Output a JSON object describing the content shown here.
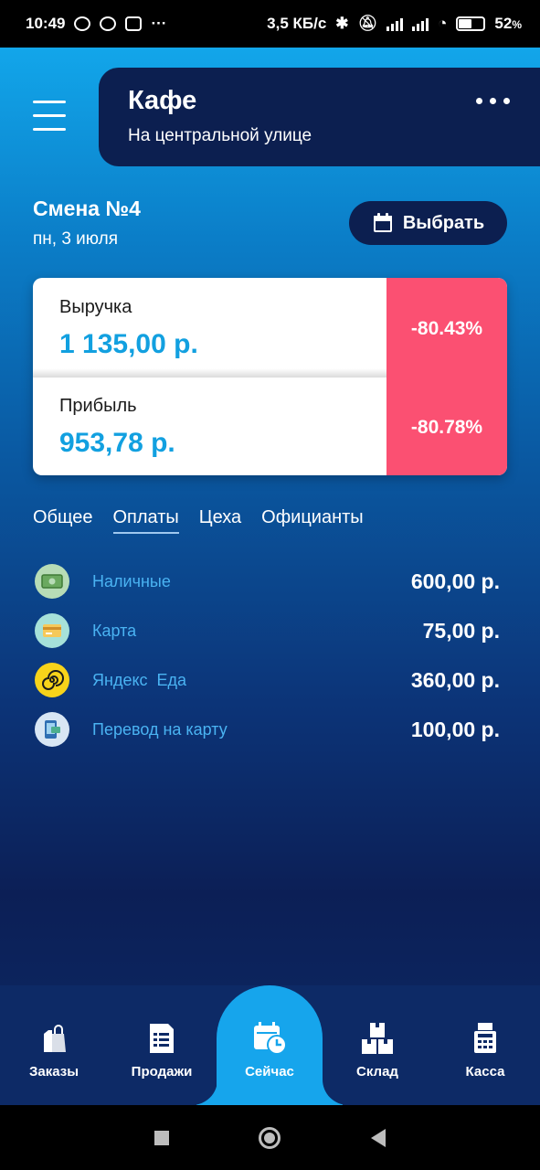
{
  "status_bar": {
    "time": "10:49",
    "more": "···",
    "speed": "3,5 КБ/с",
    "battery": "52",
    "battery_unit": "%",
    "battery_level": 0.52
  },
  "header": {
    "title": "Кафе",
    "subtitle": "На центральной улице"
  },
  "shift": {
    "title": "Смена №4",
    "date": "пн, 3 июля",
    "select_label": "Выбрать"
  },
  "stats": [
    {
      "label": "Выручка",
      "value": "1 135,00 р.",
      "change": "-80.43%"
    },
    {
      "label": "Прибыль",
      "value": "953,78 р.",
      "change": "-80.78%"
    }
  ],
  "tabs": [
    {
      "label": "Общее",
      "active": false
    },
    {
      "label": "Оплаты",
      "active": true
    },
    {
      "label": "Цеха",
      "active": false
    },
    {
      "label": "Официанты",
      "active": false
    }
  ],
  "payments": [
    {
      "label": "Наличные",
      "value": "600,00 р.",
      "icon": "cash-icon"
    },
    {
      "label": "Карта",
      "value": "75,00 р.",
      "icon": "card-icon"
    },
    {
      "label": "Яндекс  Еда",
      "value": "360,00 р.",
      "icon": "yandex-eda-icon"
    },
    {
      "label": "Перевод на карту",
      "value": "100,00 р.",
      "icon": "transfer-icon"
    }
  ],
  "bottom_nav": [
    {
      "label": "Заказы",
      "icon": "shopping-bag-icon",
      "active": false
    },
    {
      "label": "Продажи",
      "icon": "receipt-icon",
      "active": false
    },
    {
      "label": "Сейчас",
      "icon": "calendar-clock-icon",
      "active": true
    },
    {
      "label": "Склад",
      "icon": "boxes-icon",
      "active": false
    },
    {
      "label": "Касса",
      "icon": "cash-register-icon",
      "active": false
    }
  ],
  "colors": {
    "accent": "#12a0e0",
    "negative": "#fb5072",
    "dark_navy": "#0c1f50"
  }
}
